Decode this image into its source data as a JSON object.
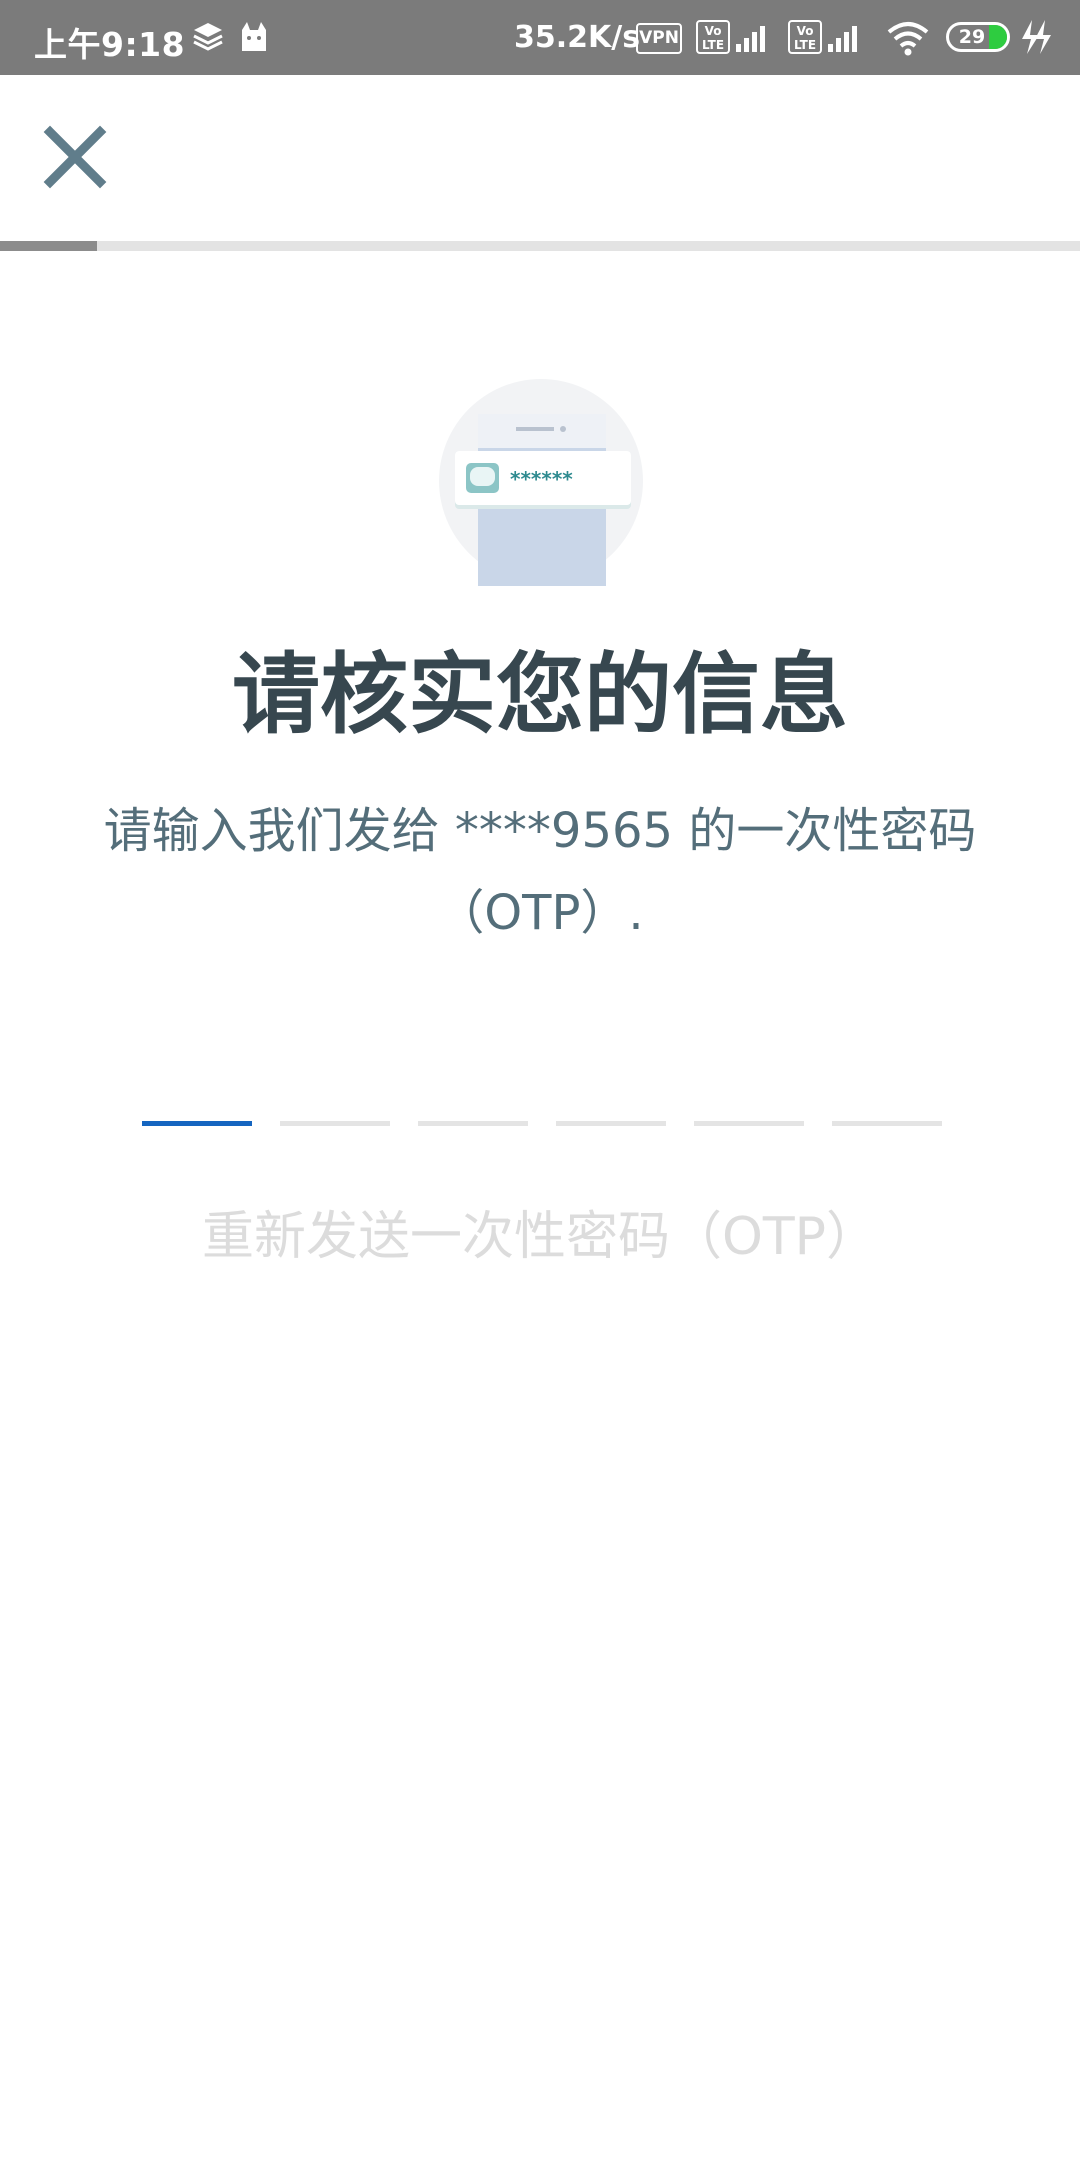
{
  "status_bar": {
    "time": "上午9:18",
    "net_speed": "35.2K/s",
    "vpn": "VPN",
    "volte_1": "Vo LTE",
    "volte_2": "Vo LTE",
    "battery": "29",
    "icons": [
      "layers-icon",
      "cat-icon",
      "vpn-icon",
      "volte-icon",
      "signal-icon",
      "wifi-icon",
      "battery-icon",
      "charging-icon"
    ]
  },
  "header": {
    "close_icon": "close-icon",
    "progress_fraction": 0.09
  },
  "illustration": {
    "masked_code": "******"
  },
  "main": {
    "title": "请核实您的信息",
    "subtitle_line1": "请输入我们发给 ****9565 的一次性密码",
    "subtitle_line2": "（OTP）.",
    "otp_length": 6,
    "otp_active_index": 0,
    "resend_label": "重新发送一次性密码（OTP）"
  },
  "colors": {
    "status_bar": "#7b7b7b",
    "title": "#37474f",
    "subtitle": "#546e7a",
    "otp_active": "#1565c0",
    "otp_inactive": "#e4e4e4",
    "resend_disabled": "#dcdcdc",
    "close_icon": "#607d8b",
    "battery_fill": "#2ecc40"
  }
}
